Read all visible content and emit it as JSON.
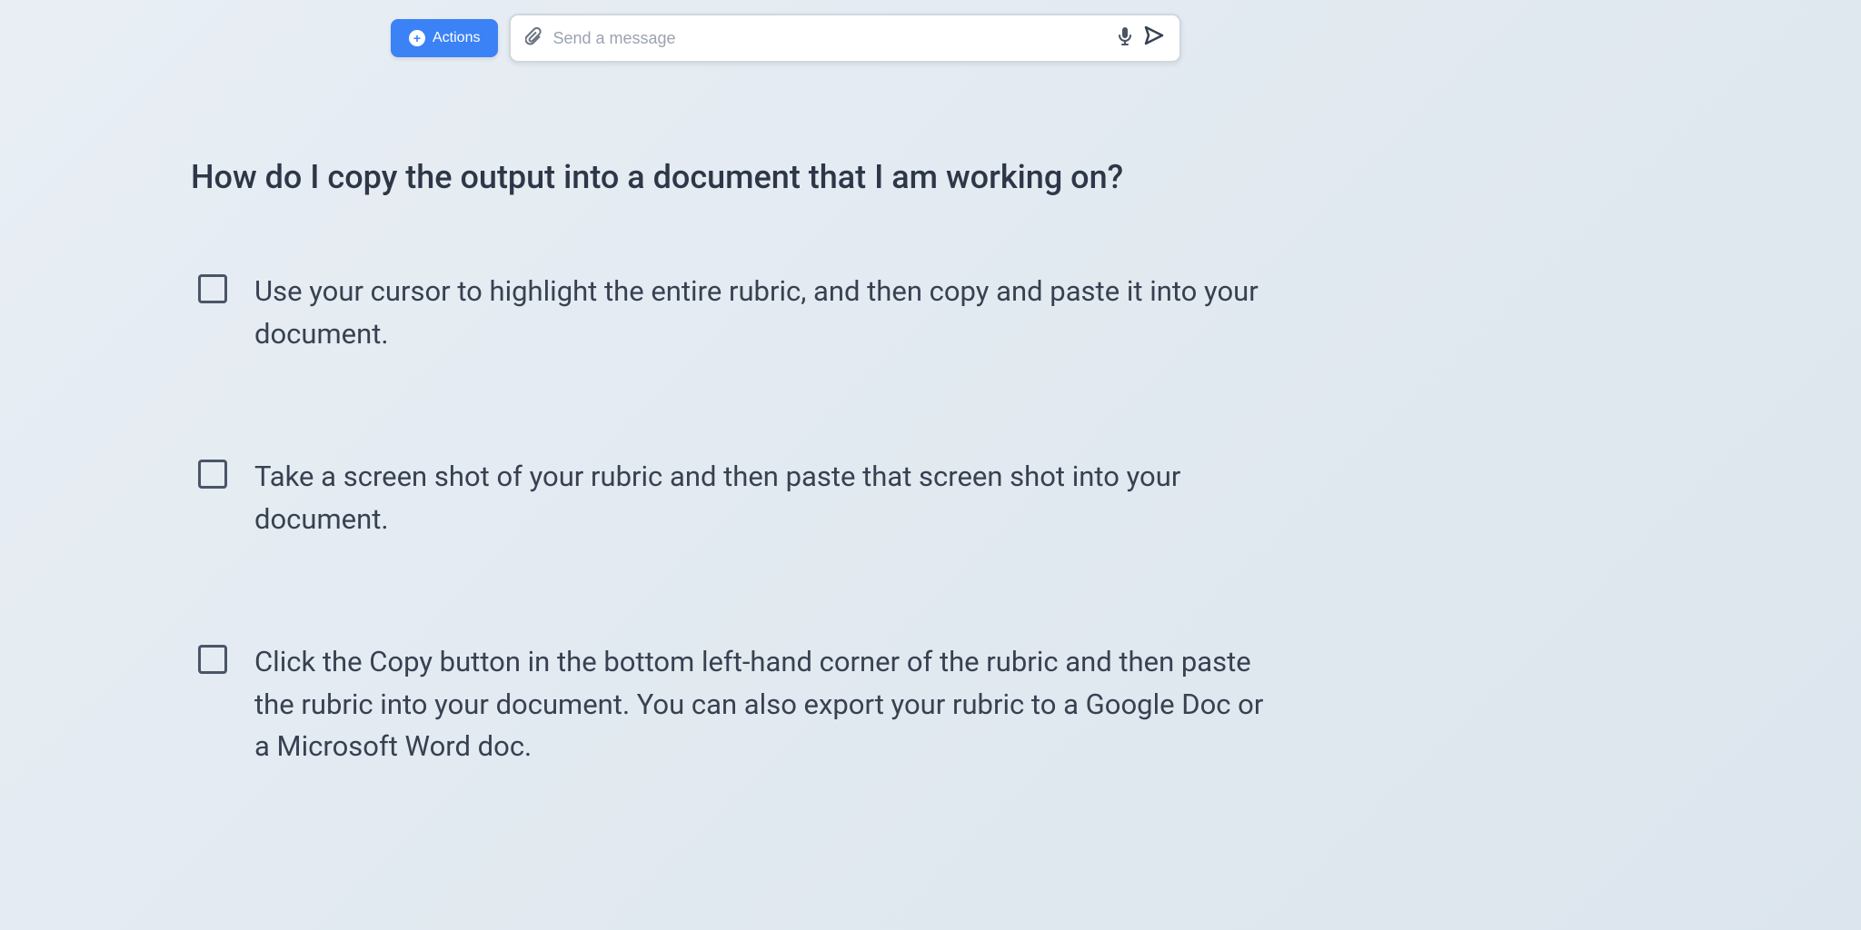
{
  "chatbar": {
    "actions_label": "Actions",
    "message_placeholder": "Send a message"
  },
  "quiz": {
    "question": "How do I copy the output into a document that I am working on?",
    "options": [
      {
        "text": "Use your cursor to highlight the entire rubric, and then copy and paste it into your document."
      },
      {
        "text": "Take a screen shot of your rubric and then paste that screen shot into your document."
      },
      {
        "text": "Click the Copy button in the bottom left-hand corner of the rubric and then paste the rubric into your document. You can also export your rubric to a Google Doc or a Microsoft Word doc."
      }
    ]
  }
}
